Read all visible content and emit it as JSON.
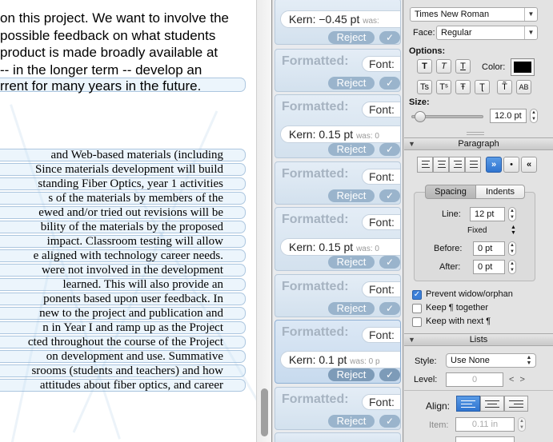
{
  "document": {
    "sans_lines": [
      "on this project. We want to involve the",
      "possible feedback on what students",
      "product is made broadly available at",
      "-- in the longer term -- develop an",
      "rrent for many years in the future."
    ],
    "serif_lines": [
      "and Web-based materials (including",
      "Since materials development will build",
      "standing Fiber Optics, year 1 activities",
      "s of the materials by members of the",
      "ewed and/or tried out revisions will be",
      "bility of the materials by the proposed",
      "impact.  Classroom testing will allow",
      "e aligned with technology career needs.",
      "were not involved in the development",
      "learned.   This will also provide an",
      "ponents based upon user feedback.  In",
      "new to the project and publication and",
      "n in Year I and ramp up as the Project",
      "cted throughout the course of the Project",
      "on development and use.  Summative",
      "srooms (students and teachers) and how",
      "attitudes about fiber optics, and career"
    ]
  },
  "changes": {
    "blocks": [
      {
        "kind": "kern",
        "kern": "Kern: −0.45 pt",
        "was": "was:",
        "reject": "Reject",
        "accept": "✓"
      },
      {
        "kind": "font",
        "formatted": "Formatted:",
        "font": "Font:",
        "reject": "Reject",
        "accept": "✓"
      },
      {
        "kind": "font-kern",
        "formatted": "Formatted:",
        "font": "Font:",
        "kern": "Kern: 0.15 pt",
        "was": "was: 0",
        "reject": "Reject",
        "accept": "✓"
      },
      {
        "kind": "font",
        "formatted": "Formatted:",
        "font": "Font:",
        "reject": "Reject",
        "accept": "✓"
      },
      {
        "kind": "font-kern",
        "formatted": "Formatted:",
        "font": "Font:",
        "kern": "Kern: 0.15 pt",
        "was": "was: 0",
        "reject": "Reject",
        "accept": "✓"
      },
      {
        "kind": "font",
        "formatted": "Formatted:",
        "font": "Font:",
        "reject": "Reject",
        "accept": "✓"
      },
      {
        "kind": "font-kern",
        "formatted": "Formatted:",
        "font": "Font:",
        "kern": "Kern: 0.1 pt",
        "was": "was: 0 p",
        "reject": "Reject",
        "accept": "✓"
      },
      {
        "kind": "font",
        "formatted": "Formatted:",
        "font": "Font:",
        "reject": "Reject",
        "accept": "✓"
      }
    ]
  },
  "inspector": {
    "font_family": "Times New Roman",
    "face_label": "Face:",
    "face_value": "Regular",
    "options_label": "Options:",
    "option_buttons": [
      "T",
      "T",
      "T"
    ],
    "color_label": "Color:",
    "color_value": "#000000",
    "script_buttons": [
      "Ts",
      "Tˢ",
      "Ŧ",
      "Ʈ",
      "T̃",
      "AB"
    ],
    "size_label": "Size:",
    "size_value": "12.0 pt",
    "size_slider_fraction": 0.05,
    "paragraph_header": "Paragraph",
    "direction_buttons": [
      "»",
      "•",
      "«"
    ],
    "tabs": [
      "Spacing",
      "Indents"
    ],
    "line_label": "Line:",
    "line_value": "12 pt",
    "line_mode": "Fixed",
    "before_label": "Before:",
    "before_value": "0 pt",
    "after_label": "After:",
    "after_value": "0 pt",
    "checkboxes": [
      {
        "label": "Prevent widow/orphan",
        "checked": true
      },
      {
        "label": "Keep ¶ together",
        "checked": false
      },
      {
        "label": "Keep with next ¶",
        "checked": false
      }
    ],
    "lists_header": "Lists",
    "style_label": "Style:",
    "style_value": "Use None",
    "level_label": "Level:",
    "level_value": "0",
    "level_arrows": "< >",
    "align_label": "Align:",
    "item_label": "Item:",
    "item_value": "0.11 in"
  }
}
